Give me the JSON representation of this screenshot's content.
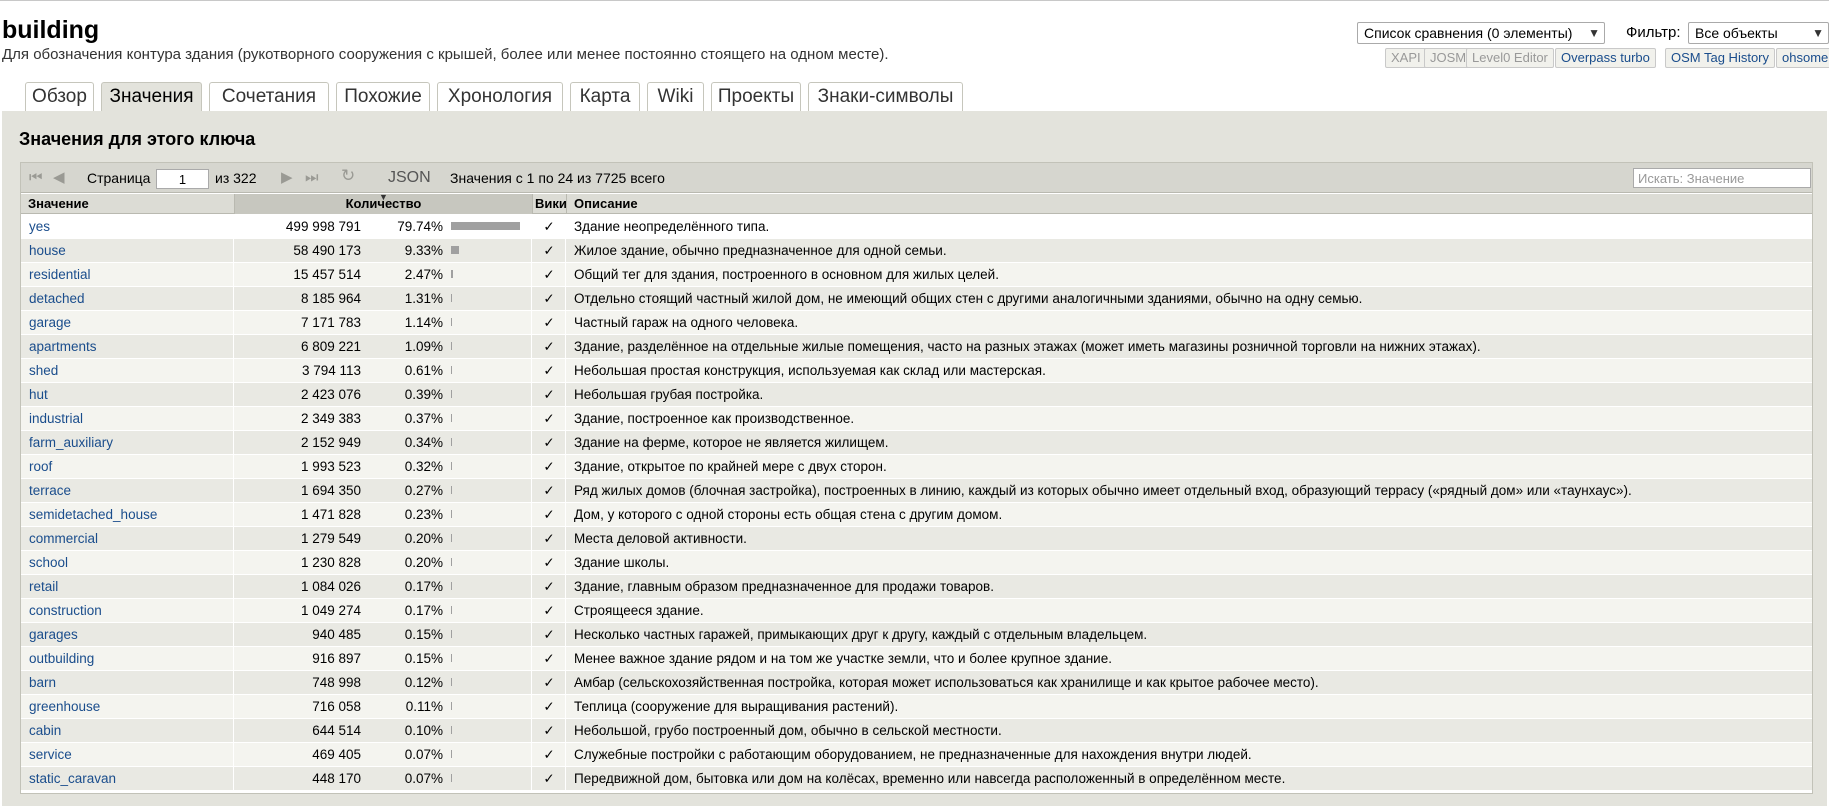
{
  "header": {
    "key": "building",
    "description": "Для обозначения контура здания (рукотворного сооружения с крышей, более или менее постоянно стоящего на одном месте).",
    "compare_list": "Список сравнения (0 элементы)",
    "filter_label": "Фильтр:",
    "filter_value": "Все объекты",
    "links": [
      "XAPI",
      "JOSM",
      "Level0 Editor",
      "Overpass turbo",
      "OSM Tag History",
      "ohsome"
    ]
  },
  "tabs": [
    "Обзор",
    "Значения",
    "Сочетания",
    "Похожие",
    "Хронология",
    "Карта",
    "Wiki",
    "Проекты",
    "Знаки-символы"
  ],
  "active_tab": "Значения",
  "section": {
    "title": "Значения для этого ключа"
  },
  "pager": {
    "page_label": "Страница",
    "page": "1",
    "of": "из 322",
    "json": "JSON",
    "range": "Значения с 1 по 24 из 7725 всего",
    "search_placeholder": "Искать: Значение"
  },
  "columns": {
    "value": "Значение",
    "count": "Количество",
    "wiki": "Вики",
    "description": "Описание"
  },
  "rows": [
    {
      "value": "yes",
      "count": "499 998 791",
      "pct": "79.74%",
      "fraction": 0.7974,
      "wiki": "✓",
      "desc": "Здание неопределённого типа."
    },
    {
      "value": "house",
      "count": "58 490 173",
      "pct": "9.33%",
      "fraction": 0.0933,
      "wiki": "✓",
      "desc": "Жилое здание, обычно предназначенное для одной семьи."
    },
    {
      "value": "residential",
      "count": "15 457 514",
      "pct": "2.47%",
      "fraction": 0.0247,
      "wiki": "✓",
      "desc": "Общий тег для здания, построенного в основном для жилых целей."
    },
    {
      "value": "detached",
      "count": "8 185 964",
      "pct": "1.31%",
      "fraction": 0.0131,
      "wiki": "✓",
      "desc": "Отдельно стоящий частный жилой дом, не имеющий общих стен с другими аналогичными зданиями, обычно на одну семью."
    },
    {
      "value": "garage",
      "count": "7 171 783",
      "pct": "1.14%",
      "fraction": 0.0114,
      "wiki": "✓",
      "desc": "Частный гараж на одного человека."
    },
    {
      "value": "apartments",
      "count": "6 809 221",
      "pct": "1.09%",
      "fraction": 0.0109,
      "wiki": "✓",
      "desc": "Здание, разделённое на отдельные жилые помещения, часто на разных этажах (может иметь магазины розничной торговли на нижних этажах)."
    },
    {
      "value": "shed",
      "count": "3 794 113",
      "pct": "0.61%",
      "fraction": 0.0061,
      "wiki": "✓",
      "desc": "Небольшая простая конструкция, используемая как склад или мастерская."
    },
    {
      "value": "hut",
      "count": "2 423 076",
      "pct": "0.39%",
      "fraction": 0.0039,
      "wiki": "✓",
      "desc": "Небольшая грубая постройка."
    },
    {
      "value": "industrial",
      "count": "2 349 383",
      "pct": "0.37%",
      "fraction": 0.0037,
      "wiki": "✓",
      "desc": "Здание, построенное как производственное."
    },
    {
      "value": "farm_auxiliary",
      "count": "2 152 949",
      "pct": "0.34%",
      "fraction": 0.0034,
      "wiki": "✓",
      "desc": "Здание на ферме, которое не является жилищем."
    },
    {
      "value": "roof",
      "count": "1 993 523",
      "pct": "0.32%",
      "fraction": 0.0032,
      "wiki": "✓",
      "desc": "Здание, открытое по крайней мере с двух сторон."
    },
    {
      "value": "terrace",
      "count": "1 694 350",
      "pct": "0.27%",
      "fraction": 0.0027,
      "wiki": "✓",
      "desc": "Ряд жилых домов (блочная застройка), построенных в линию, каждый из которых обычно имеет отдельный вход, образующий террасу («рядный дом» или «таунхаус»)."
    },
    {
      "value": "semidetached_house",
      "count": "1 471 828",
      "pct": "0.23%",
      "fraction": 0.0023,
      "wiki": "✓",
      "desc": "Дом, у которого с одной стороны есть общая стена с другим домом."
    },
    {
      "value": "commercial",
      "count": "1 279 549",
      "pct": "0.20%",
      "fraction": 0.002,
      "wiki": "✓",
      "desc": "Места деловой активности."
    },
    {
      "value": "school",
      "count": "1 230 828",
      "pct": "0.20%",
      "fraction": 0.002,
      "wiki": "✓",
      "desc": "Здание школы."
    },
    {
      "value": "retail",
      "count": "1 084 026",
      "pct": "0.17%",
      "fraction": 0.0017,
      "wiki": "✓",
      "desc": "Здание, главным образом предназначенное для продажи товаров."
    },
    {
      "value": "construction",
      "count": "1 049 274",
      "pct": "0.17%",
      "fraction": 0.0017,
      "wiki": "✓",
      "desc": "Строящееся здание."
    },
    {
      "value": "garages",
      "count": "940 485",
      "pct": "0.15%",
      "fraction": 0.0015,
      "wiki": "✓",
      "desc": "Несколько частных гаражей, примыкающих друг к другу, каждый с отдельным владельцем."
    },
    {
      "value": "outbuilding",
      "count": "916 897",
      "pct": "0.15%",
      "fraction": 0.0015,
      "wiki": "✓",
      "desc": "Менее важное здание рядом и на том же участке земли, что и более крупное здание."
    },
    {
      "value": "barn",
      "count": "748 998",
      "pct": "0.12%",
      "fraction": 0.0012,
      "wiki": "✓",
      "desc": "Амбар (сельскохозяйственная постройка, которая может использоваться как хранилище и как крытое рабочее место)."
    },
    {
      "value": "greenhouse",
      "count": "716 058",
      "pct": "0.11%",
      "fraction": 0.0011,
      "wiki": "✓",
      "desc": "Теплица (сооружение для выращивания растений)."
    },
    {
      "value": "cabin",
      "count": "644 514",
      "pct": "0.10%",
      "fraction": 0.001,
      "wiki": "✓",
      "desc": "Небольшой, грубо построенный дом, обычно в сельской местности."
    },
    {
      "value": "service",
      "count": "469 405",
      "pct": "0.07%",
      "fraction": 0.0007,
      "wiki": "✓",
      "desc": "Служебные постройки с работающим оборудованием, не предназначенные для нахождения внутри людей."
    },
    {
      "value": "static_caravan",
      "count": "448 170",
      "pct": "0.07%",
      "fraction": 0.0007,
      "wiki": "✓",
      "desc": "Передвижной дом, бытовка или дом на колёсах, временно или навсегда расположенный в определённом месте."
    }
  ]
}
